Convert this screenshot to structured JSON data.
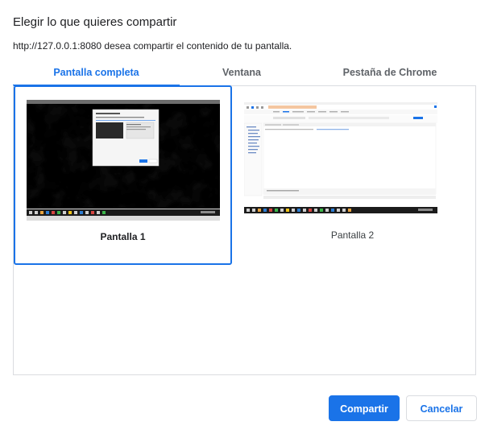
{
  "dialog": {
    "title": "Elegir lo que quieres compartir",
    "subtitle": "http://127.0.0.1:8080 desea compartir el contenido de tu pantalla."
  },
  "tabs": [
    {
      "label": "Pantalla completa",
      "active": true
    },
    {
      "label": "Ventana",
      "active": false
    },
    {
      "label": "Pestaña de Chrome",
      "active": false
    }
  ],
  "screens": [
    {
      "label": "Pantalla 1",
      "selected": true
    },
    {
      "label": "Pantalla 2",
      "selected": false
    }
  ],
  "buttons": {
    "share": "Compartir",
    "cancel": "Cancelar"
  },
  "colors": {
    "accent": "#1a73e8",
    "border": "#dadce0",
    "text": "#202124"
  }
}
